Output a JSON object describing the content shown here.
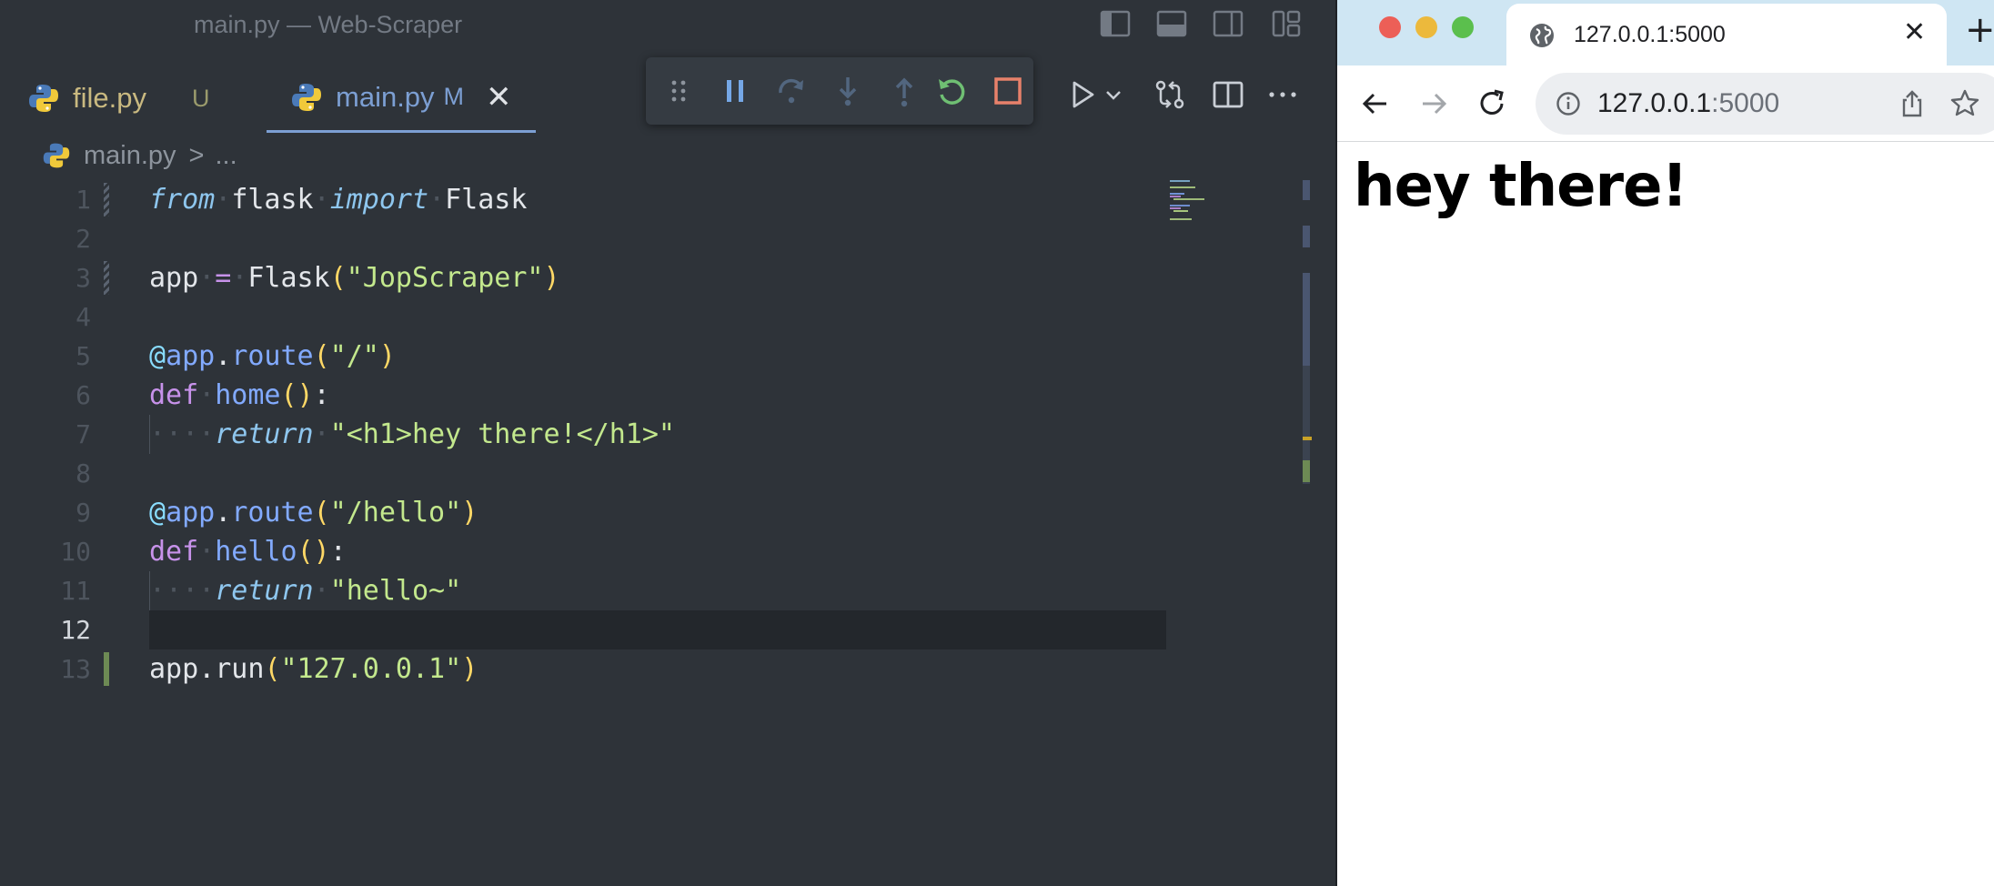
{
  "editor": {
    "window_title": "main.py — Web-Scraper",
    "tabs": [
      {
        "label": "file.py",
        "status": "U"
      },
      {
        "label": "main.py",
        "status": "M",
        "close": "✕"
      }
    ],
    "breadcrumb": {
      "file": "main.py",
      "separator": ">",
      "rest": "..."
    },
    "line_numbers": [
      "1",
      "2",
      "3",
      "4",
      "5",
      "6",
      "7",
      "8",
      "9",
      "10",
      "11",
      "12",
      "13"
    ],
    "active_line": 12,
    "colors": {
      "accent": "#7c9fd3",
      "string": "#c3e88d",
      "keyword": "#c792ea",
      "function": "#82aaff",
      "paren": "#ffd866"
    }
  },
  "code": {
    "l1": {
      "from": "from",
      "module": "flask",
      "import": "import",
      "name": "Flask"
    },
    "l3": {
      "var": "app",
      "eq": "=",
      "cls": "Flask",
      "open": "(",
      "arg": "\"JopScraper\"",
      "close": ")"
    },
    "l5": {
      "at": "@",
      "obj": "app",
      "dot": ".",
      "method": "route",
      "open": "(",
      "arg": "\"/\"",
      "close": ")"
    },
    "l6": {
      "def": "def",
      "name": "home",
      "parens": "()",
      "colon": ":"
    },
    "l7": {
      "return": "return",
      "value": "\"<h1>hey there!</h1>\""
    },
    "l9": {
      "at": "@",
      "obj": "app",
      "dot": ".",
      "method": "route",
      "open": "(",
      "arg": "\"/hello\"",
      "close": ")"
    },
    "l10": {
      "def": "def",
      "name": "hello",
      "parens": "()",
      "colon": ":"
    },
    "l11": {
      "return": "return",
      "value": "\"hello~\""
    },
    "l13": {
      "obj": "app",
      "dot": ".",
      "method": "run",
      "open": "(",
      "arg": "\"127.0.0.1\"",
      "close": ")"
    }
  },
  "browser": {
    "tab_title": "127.0.0.1:5000",
    "tab_close": "✕",
    "new_tab": "+",
    "url_host": "127.0.0.1",
    "url_port": ":5000",
    "heading": "hey there!"
  }
}
